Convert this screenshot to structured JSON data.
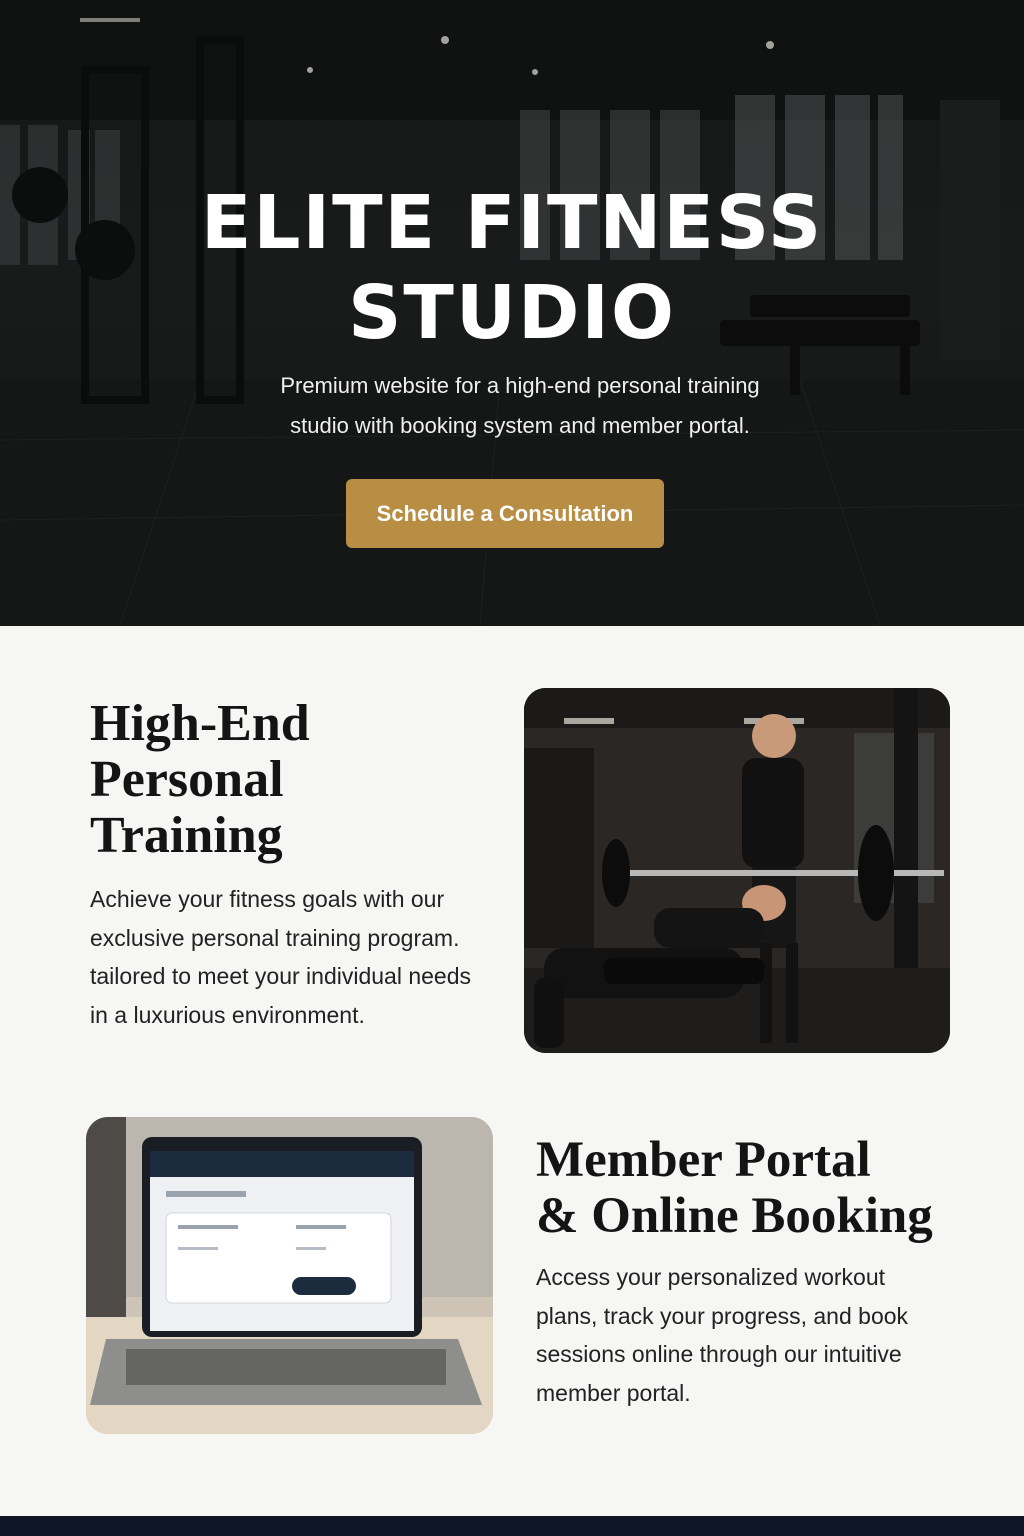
{
  "hero": {
    "title_line1": "ELITE FITNESS",
    "title_line2": "STUDIO",
    "subtitle": "Premium website for a high-end personal training studio with booking system and member portal.",
    "cta_label": "Schedule a Consultation",
    "cta_color": "#b88d44"
  },
  "section_training": {
    "title_line1": "High-End",
    "title_line2": "Personal",
    "title_line3": "Training",
    "body": "Achieve your fitness goals with our exclusive personal training program. tailored to meet your individual needs in a luxurious environment.",
    "image": "trainer-spotting-bench-press-photo"
  },
  "section_portal": {
    "title_line1": "Member Portal",
    "title_line2": "& Online Booking",
    "body": "Access your personalized workout plans, track your progress, and book sessions online through our intuitive member portal.",
    "image": "laptop-member-portal-photo"
  },
  "colors": {
    "hero_dark": "#1c1e1e",
    "page_bg": "#f6f6f5",
    "footer": "#0e1626",
    "accent_gold": "#b88d44"
  }
}
